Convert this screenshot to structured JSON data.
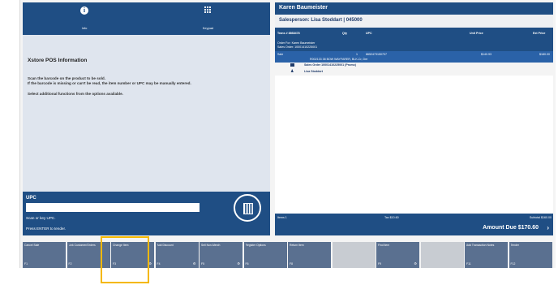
{
  "tabs": [
    {
      "label": "Info",
      "icon": "info-icon"
    },
    {
      "label": "Keypad",
      "icon": "keypad-icon"
    }
  ],
  "info": {
    "title": "Xstore POS Information",
    "lines": [
      "Scan the barcode on the product to be sold.",
      "If the barcode is missing or can't be read, the item number or UPC may be manually entered.",
      "Select additional functions from the options available."
    ]
  },
  "upc": {
    "label": "UPC",
    "value": "",
    "hint1": "Scan or key UPC.",
    "hint2": "Press ENTER to tender."
  },
  "customer": {
    "name": "Karen Baumeister"
  },
  "salesperson": {
    "text": "Salesperson:  Lisa Stoddart | 045000"
  },
  "columns": {
    "trans": "Trans # 8868478",
    "qty": "Qty",
    "upc": "UPC",
    "unit_price": "Unit Price",
    "ext_price": "Ext Price"
  },
  "order_info": {
    "line1": "Order For: Karen Baumeister",
    "line2": "Sales Order: 10001410225001"
  },
  "line_item": {
    "type": "Sale",
    "qty": "1",
    "upc": "8652473150707",
    "desc": "R002133 38 BOW WAYFARER, BLK-Cr, Dre",
    "unit_price": "$140.93",
    "ext_price": "$180.00"
  },
  "sub_rows": [
    {
      "icon": "register-icon",
      "text": "Sales Order 10001410225001 (Promo)"
    },
    {
      "icon": "person-icon",
      "text": "Lisa Stoddart"
    }
  ],
  "totals": {
    "items": "Items 1",
    "tax": "Tax $10.60",
    "subtotal": "Subtotal $160.00"
  },
  "amount_due": {
    "label": "Amount Due  $170.60",
    "arrow": "›"
  },
  "fkeys": [
    {
      "label": "Cancel Sale",
      "num": "F1",
      "gear": false,
      "blank": false
    },
    {
      "label": "Link Customer/Orders",
      "num": "F2",
      "gear": false,
      "blank": false
    },
    {
      "label": "Change Item",
      "num": "F3",
      "gear": true,
      "blank": false
    },
    {
      "label": "Add Discount",
      "num": "F4",
      "gear": true,
      "blank": false
    },
    {
      "label": "Sell Non-Merch",
      "num": "F5",
      "gear": true,
      "blank": false
    },
    {
      "label": "Register Options",
      "num": "F6",
      "gear": false,
      "blank": false
    },
    {
      "label": "Return Item",
      "num": "F8",
      "gear": false,
      "blank": false
    },
    {
      "label": "",
      "num": "",
      "gear": false,
      "blank": true
    },
    {
      "label": "Find Item",
      "num": "F9",
      "gear": true,
      "blank": false
    },
    {
      "label": "",
      "num": "",
      "gear": false,
      "blank": true
    },
    {
      "label": "Add Transaction Notes",
      "num": "F11",
      "gear": false,
      "blank": false
    },
    {
      "label": "Tender",
      "num": "F12",
      "gear": false,
      "blank": false
    }
  ],
  "colors": {
    "brand_blue": "#1f4e84",
    "selected_row": "#2a62a8",
    "fkey_bg": "#5a7090",
    "highlight": "#f4b800"
  }
}
